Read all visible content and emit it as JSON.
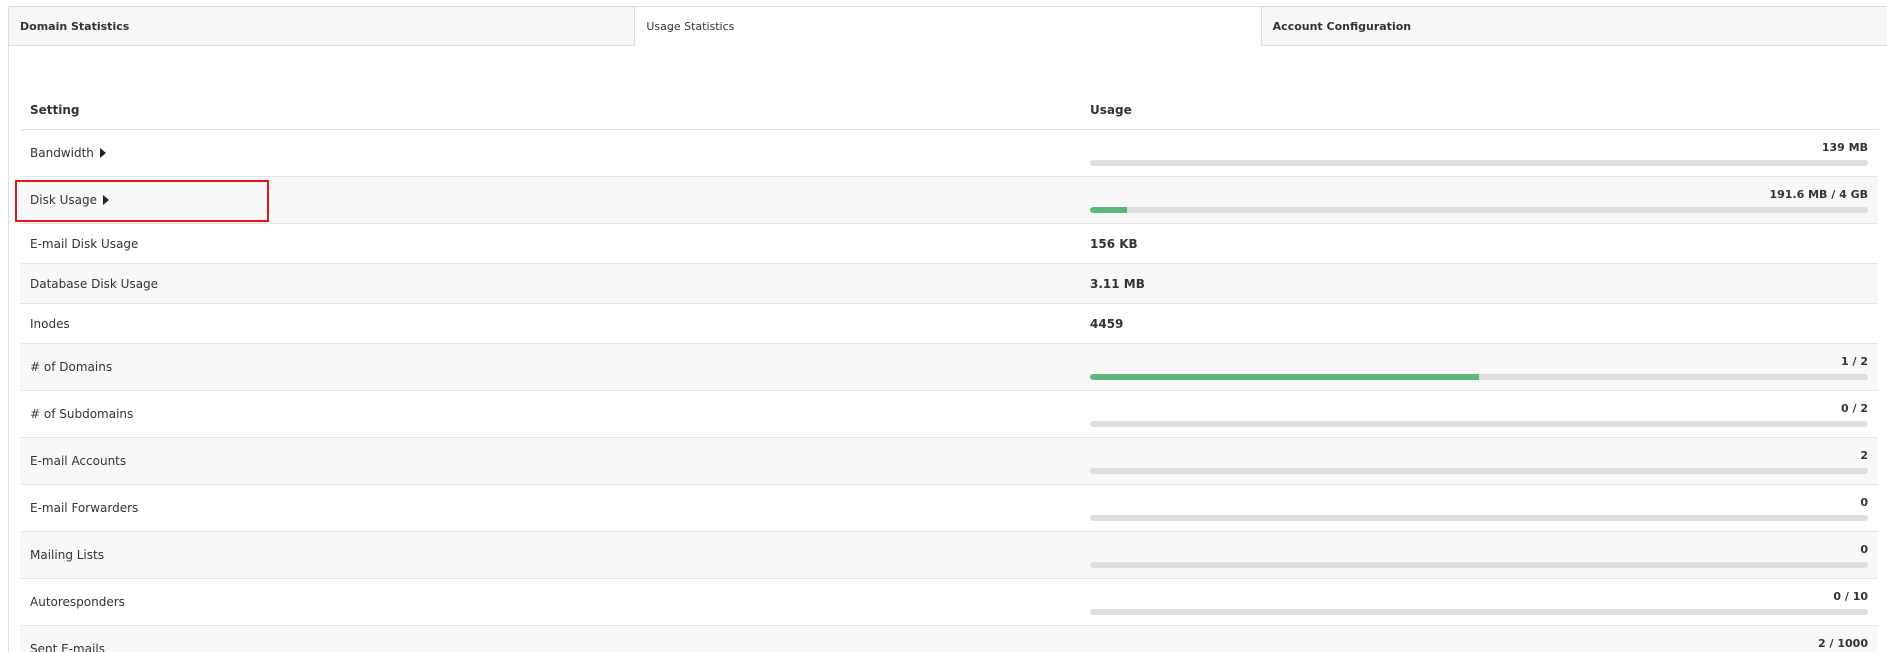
{
  "tabs": [
    {
      "label": "Domain Statistics",
      "active": false
    },
    {
      "label": "Usage Statistics",
      "active": true
    },
    {
      "label": "Account Configuration",
      "active": false
    }
  ],
  "table": {
    "headers": {
      "setting": "Setting",
      "usage": "Usage"
    },
    "rows": [
      {
        "setting": "Bandwidth",
        "expandable": true,
        "usage": "139 MB",
        "type": "bar",
        "fill_percent": 0
      },
      {
        "setting": "Disk Usage",
        "expandable": true,
        "usage": "191.6 MB / 4 GB",
        "type": "bar",
        "fill_percent": 4.7
      },
      {
        "setting": "E-mail Disk Usage",
        "expandable": false,
        "usage": "156 KB",
        "type": "text"
      },
      {
        "setting": "Database Disk Usage",
        "expandable": false,
        "usage": "3.11 MB",
        "type": "text"
      },
      {
        "setting": "Inodes",
        "expandable": false,
        "usage": "4459",
        "type": "text"
      },
      {
        "setting": "# of Domains",
        "expandable": false,
        "usage": "1 / 2",
        "type": "bar",
        "fill_percent": 50
      },
      {
        "setting": "# of Subdomains",
        "expandable": false,
        "usage": "0 / 2",
        "type": "bar",
        "fill_percent": 0
      },
      {
        "setting": "E-mail Accounts",
        "expandable": false,
        "usage": "2",
        "type": "bar",
        "fill_percent": 0
      },
      {
        "setting": "E-mail Forwarders",
        "expandable": false,
        "usage": "0",
        "type": "bar",
        "fill_percent": 0
      },
      {
        "setting": "Mailing Lists",
        "expandable": false,
        "usage": "0",
        "type": "bar",
        "fill_percent": 0
      },
      {
        "setting": "Autoresponders",
        "expandable": false,
        "usage": "0 / 10",
        "type": "bar",
        "fill_percent": 0
      },
      {
        "setting": "Sent E-mails",
        "expandable": false,
        "usage": "2 / 1000",
        "type": "bar",
        "fill_percent": 0.2
      }
    ]
  },
  "colors": {
    "bar_fill": "#5cb87a",
    "bar_track": "#dedede",
    "highlight": "#e0161a"
  },
  "icons": {
    "expand": "caret-right-icon"
  }
}
